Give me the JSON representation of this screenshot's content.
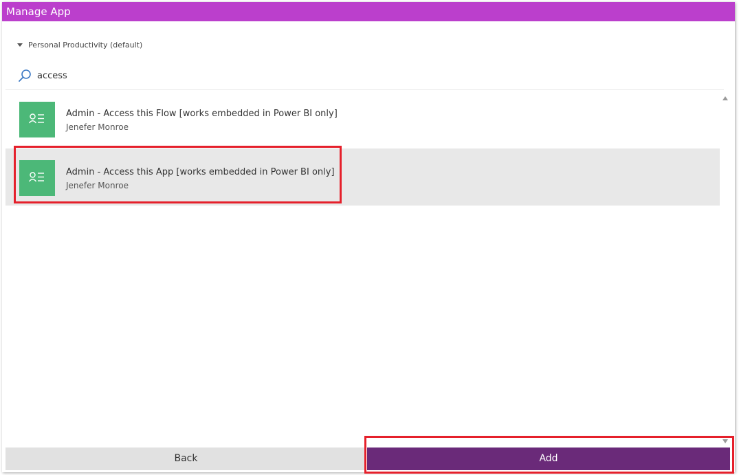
{
  "window": {
    "title": "Manage App"
  },
  "environment": {
    "label": "Personal Productivity (default)"
  },
  "search": {
    "value": "access"
  },
  "results": [
    {
      "title": "Admin - Access this Flow [works embedded in Power BI only]",
      "owner": "Jenefer Monroe",
      "icon": "app-icon",
      "selected": false
    },
    {
      "title": "Admin - Access this App [works embedded in Power BI only]",
      "owner": "Jenefer Monroe",
      "icon": "app-icon",
      "selected": true
    }
  ],
  "footer": {
    "back_label": "Back",
    "add_label": "Add"
  },
  "colors": {
    "titlebar": "#bb3fcc",
    "app_tile": "#4cb878",
    "add_button": "#6a2a79",
    "back_button": "#e1e1e1",
    "selected_row": "#e8e8e8",
    "highlight": "#e5202b"
  }
}
